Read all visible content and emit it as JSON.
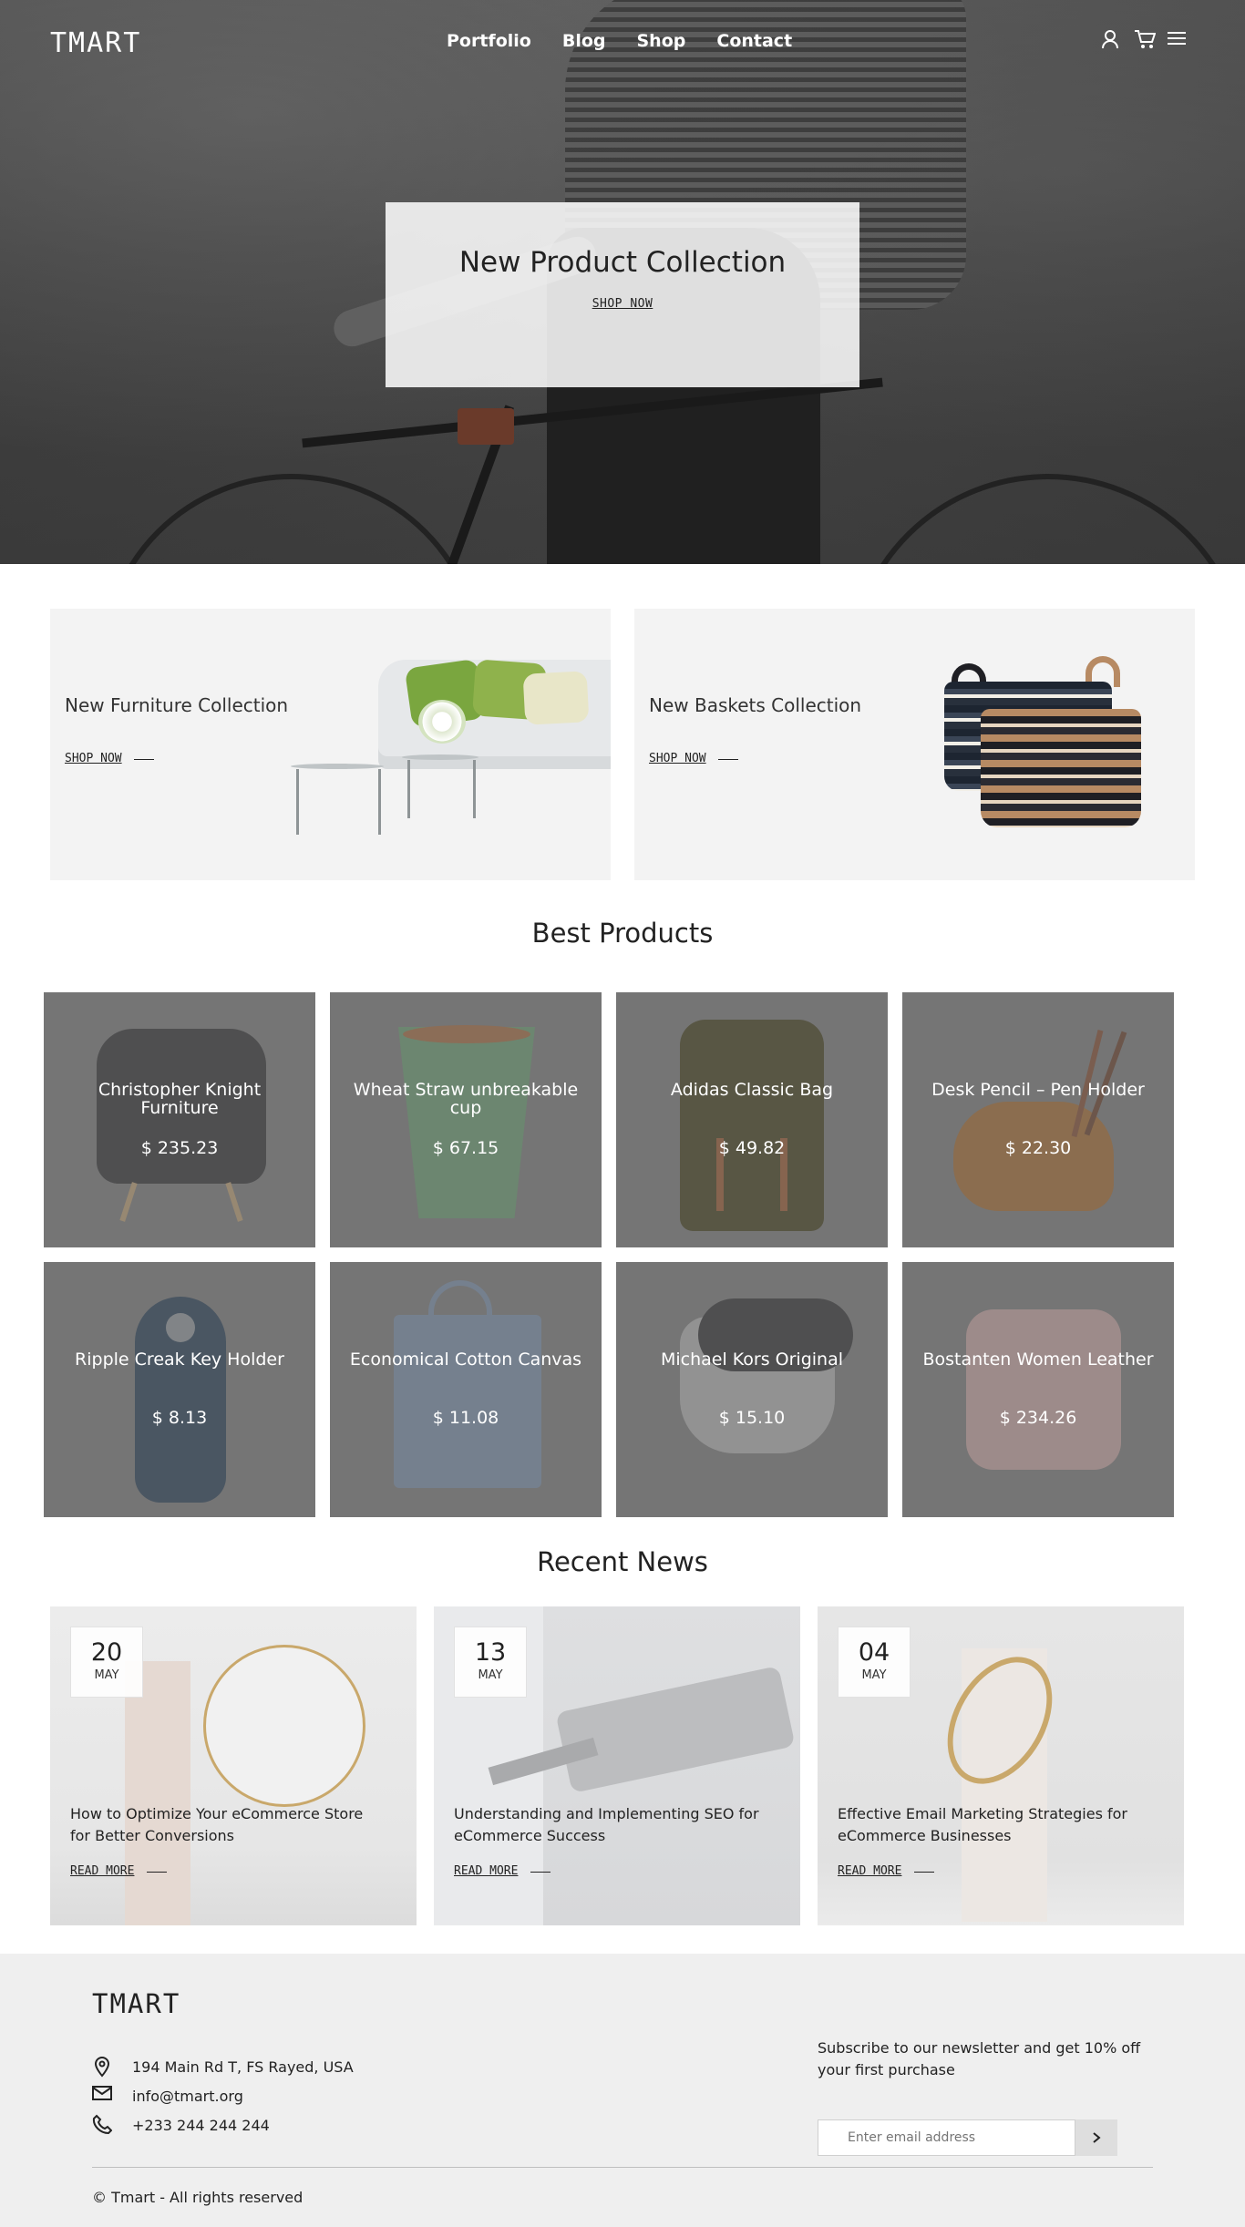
{
  "header": {
    "logo": "TMART",
    "menu": [
      "Portfolio",
      "Blog",
      "Shop",
      "Contact"
    ],
    "icons": [
      "user-icon",
      "cart-icon",
      "hamburger-menu-icon"
    ]
  },
  "hero": {
    "title": "New Product Collection",
    "cta": "SHOP NOW"
  },
  "collections": [
    {
      "title": "New Furniture Collection",
      "cta": "SHOP NOW"
    },
    {
      "title": "New Baskets Collection",
      "cta": "SHOP NOW"
    }
  ],
  "best_products": {
    "title": "Best Products",
    "items": [
      {
        "name": "Christopher Knight Furniture",
        "price": "$ 235.23"
      },
      {
        "name": "Wheat Straw unbreakable cup",
        "price": "$ 67.15"
      },
      {
        "name": "Adidas Classic Bag",
        "price": "$ 49.82"
      },
      {
        "name": "Desk Pencil – Pen Holder",
        "price": "$ 22.30"
      },
      {
        "name": "Ripple Creak Key Holder",
        "price": "$ 8.13"
      },
      {
        "name": "Economical Cotton Canvas",
        "price": "$ 11.08"
      },
      {
        "name": "Michael Kors Original",
        "price": "$ 15.10"
      },
      {
        "name": "Bostanten Women Leather",
        "price": "$ 234.26"
      }
    ]
  },
  "recent_news": {
    "title": "Recent News",
    "items": [
      {
        "day": "20",
        "month": "MAY",
        "title": "How to Optimize Your eCommerce Store for Better Conversions",
        "cta": "READ MORE"
      },
      {
        "day": "13",
        "month": "MAY",
        "title": "Understanding and Implementing SEO for eCommerce Success",
        "cta": "READ MORE"
      },
      {
        "day": "04",
        "month": "MAY",
        "title": "Effective Email Marketing Strategies for eCommerce Businesses",
        "cta": "READ MORE"
      }
    ]
  },
  "footer": {
    "logo": "TMART",
    "address": "194 Main Rd T, FS Rayed, USA",
    "email": "info@tmart.org",
    "phone": "+233 244 244 244",
    "newsletter_text": "Subscribe to our newsletter and get 10% off your first purchase",
    "email_placeholder": "Enter email address",
    "copyright": "© Tmart - All rights reserved"
  },
  "colors": {
    "card_bg": "#f3f3f3",
    "footer_bg": "#efefef",
    "product_overlay": "#6e6e6e",
    "text": "#222222"
  }
}
